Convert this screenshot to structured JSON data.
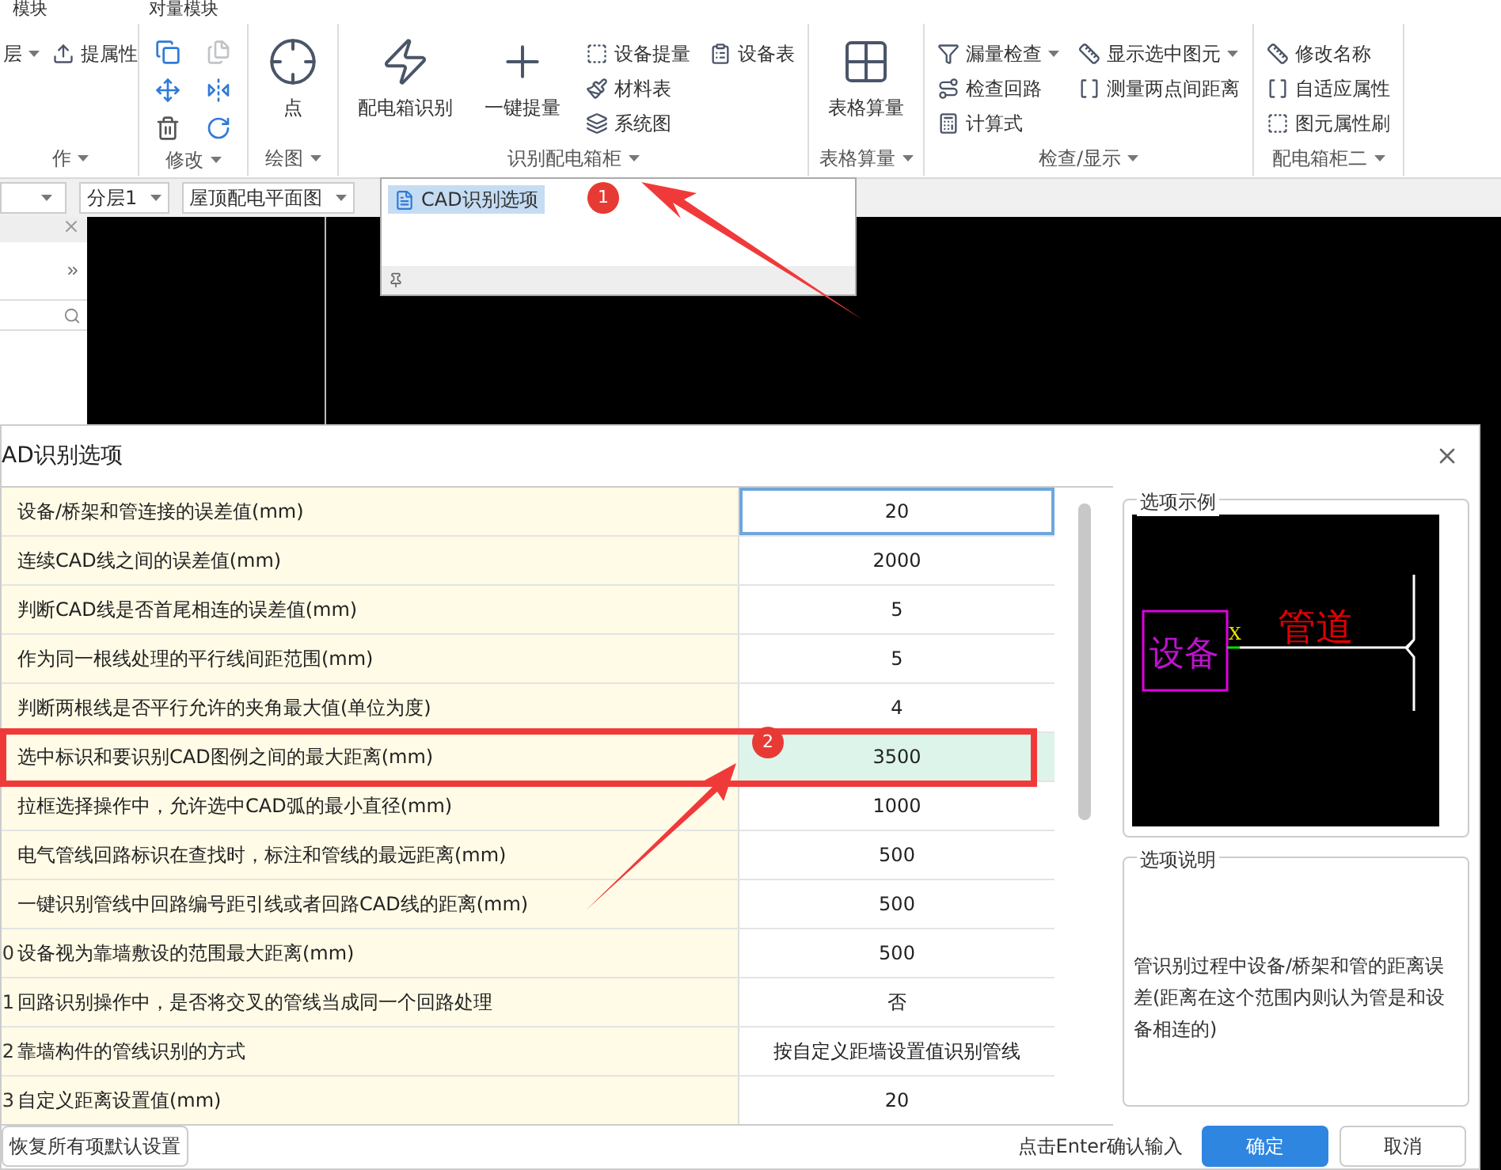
{
  "menu_tabs": [
    "模块",
    "对量模块"
  ],
  "ribbon": {
    "groups": [
      {
        "label": "作",
        "items": [
          {
            "kind": "dropdown",
            "label": "层"
          },
          {
            "kind": "small",
            "label": "提属性"
          }
        ]
      },
      {
        "label": "修改",
        "tools": [
          {
            "disabled": false
          },
          {
            "disabled": true
          },
          {
            "disabled": false
          },
          {
            "disabled": false
          },
          {
            "disabled": false
          },
          {
            "disabled": false
          }
        ]
      },
      {
        "label": "绘图",
        "items": [
          {
            "kind": "large",
            "label": "点"
          }
        ]
      },
      {
        "label": "识别配电箱柜",
        "items": [
          {
            "kind": "large",
            "label": "配电箱识别"
          },
          {
            "kind": "large",
            "label": "一键提量"
          },
          {
            "kind": "small",
            "label": "设备提量"
          },
          {
            "kind": "small",
            "label": "材料表"
          },
          {
            "kind": "small",
            "label": "系统图"
          },
          {
            "kind": "small",
            "label": "设备表"
          }
        ]
      },
      {
        "label": "表格算量",
        "items": [
          {
            "kind": "large",
            "label": "表格算量"
          }
        ]
      },
      {
        "label": "检查/显示",
        "items": [
          {
            "kind": "small",
            "label": "漏量检查",
            "caret": true
          },
          {
            "kind": "small",
            "label": "检查回路",
            "caret": false
          },
          {
            "kind": "small",
            "label": "计算式",
            "caret": false
          },
          {
            "kind": "small",
            "label": "显示选中图元",
            "caret": true
          },
          {
            "kind": "small",
            "label": "测量两点间距离",
            "caret": false
          }
        ]
      },
      {
        "label": "配电箱柜二",
        "items": [
          {
            "kind": "small",
            "label": "修改名称"
          },
          {
            "kind": "small",
            "label": "自适应属性"
          },
          {
            "kind": "small",
            "label": "图元属性刷"
          }
        ]
      }
    ]
  },
  "toolbar": {
    "selects": [
      "分层1",
      "屋顶配电平面图"
    ]
  },
  "popup": {
    "items": [
      {
        "label": "CAD识别选项",
        "selected": true
      }
    ]
  },
  "dialog": {
    "title": "AD识别选项",
    "rows": [
      {
        "label": "设备/桥架和管连接的误差值(mm)",
        "value": "20",
        "focused": true,
        "selected": false
      },
      {
        "label": "连续CAD线之间的误差值(mm)",
        "value": "2000",
        "focused": false,
        "selected": false
      },
      {
        "label": "判断CAD线是否首尾相连的误差值(mm)",
        "value": "5",
        "focused": false,
        "selected": false
      },
      {
        "label": "作为同一根线处理的平行线间距范围(mm)",
        "value": "5",
        "focused": false,
        "selected": false
      },
      {
        "label": "判断两根线是否平行允许的夹角最大值(单位为度)",
        "value": "4",
        "focused": false,
        "selected": false
      },
      {
        "label": "选中标识和要识别CAD图例之间的最大距离(mm)",
        "value": "3500",
        "focused": false,
        "selected": true
      },
      {
        "label": "拉框选择操作中，允许选中CAD弧的最小直径(mm)",
        "value": "1000",
        "focused": false,
        "selected": false
      },
      {
        "label": "电气管线回路标识在查找时，标注和管线的最远距离(mm)",
        "value": "500",
        "focused": false,
        "selected": false
      },
      {
        "label": "一键识别管线中回路编号距引线或者回路CAD线的距离(mm)",
        "value": "500",
        "focused": false,
        "selected": false
      },
      {
        "index": "0",
        "label": "设备视为靠墙敷设的范围最大距离(mm)",
        "value": "500",
        "focused": false,
        "selected": false
      },
      {
        "index": "1",
        "label": "回路识别操作中，是否将交叉的管线当成同一个回路处理",
        "value": "否",
        "focused": false,
        "selected": false
      },
      {
        "index": "2",
        "label": "靠墙构件的管线识别的方式",
        "value": "按自定义距墙设置值识别管线",
        "focused": false,
        "selected": false
      },
      {
        "index": "3",
        "label": "自定义距离设置值(mm)",
        "value": "20",
        "focused": false,
        "selected": false
      }
    ],
    "example": {
      "title": "选项示例",
      "device": "设备",
      "pipe": "管道",
      "marker": "X"
    },
    "description": {
      "title": "选项说明",
      "text": "管识别过程中设备/桥架和管的距离误差(距离在这个范围内则认为管是和设备相连的)"
    },
    "reset_button": "恢复所有项默认设置",
    "hint": "点击Enter确认输入",
    "ok_button": "确定",
    "cancel_button": "取消"
  },
  "annotations": [
    "1",
    "2"
  ]
}
